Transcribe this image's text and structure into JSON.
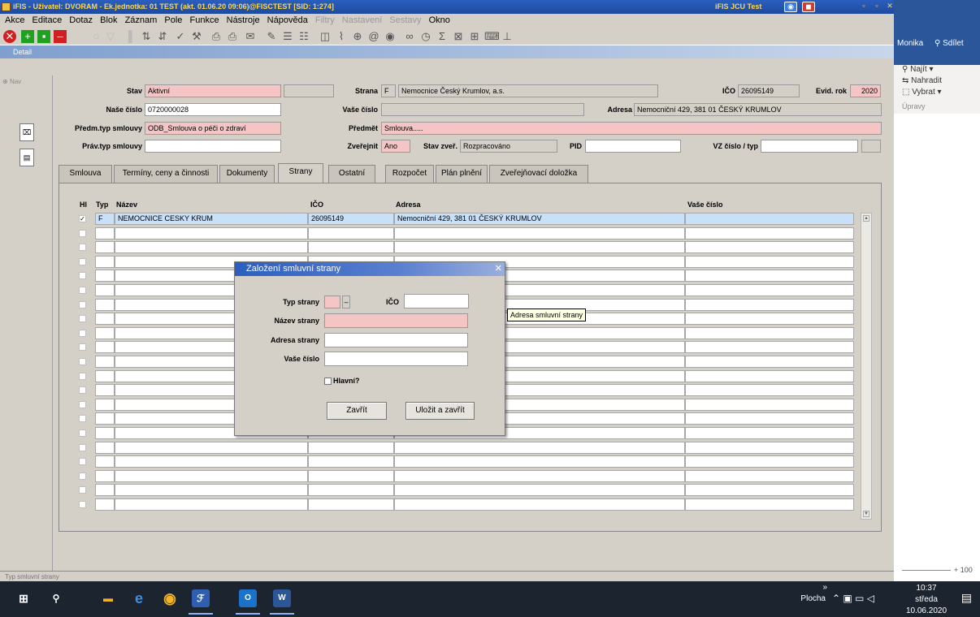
{
  "window": {
    "title": "iFIS - Uživatel: DVORAM - Ek.jednotka: 01 TEST (akt. 01.06.20 09:06)@FISCTEST [SID: 1:274]",
    "right_title": "iFIS JCU Test"
  },
  "menu": [
    "Akce",
    "Editace",
    "Dotaz",
    "Blok",
    "Záznam",
    "Pole",
    "Funkce",
    "Nástroje",
    "Nápověda"
  ],
  "menu_disabled": [
    "Filtry",
    "Nastavení",
    "Sestavy"
  ],
  "menu_last": "Okno",
  "detail_title": "Detail",
  "nav_label": "Nav",
  "form": {
    "stav_label": "Stav",
    "stav_value": "Aktivní",
    "strana_label": "Strana",
    "strana_code": "F",
    "strana_value": "Nemocnice Český Krumlov, a.s.",
    "ico_label": "IČO",
    "ico_value": "26095149",
    "evid_label": "Evid. rok",
    "evid_value": "2020",
    "nase_label": "Naše číslo",
    "nase_value": "0720000028",
    "vase_label": "Vaše číslo",
    "vase_value": "",
    "adresa_label": "Adresa",
    "adresa_value": "Nemocniční 429, 381 01 ČESKÝ KRUMLOV",
    "predm_typ_label": "Předm.typ smlouvy",
    "predm_typ_value": "ODB_Smlouva o péči o zdraví",
    "predmet_label": "Předmět",
    "predmet_value": "Smlouva.....",
    "prav_typ_label": "Práv.typ smlouvy",
    "prav_typ_value": "",
    "zverejnit_label": "Zveřejnit",
    "zverejnit_value": "Ano",
    "stav_zver_label": "Stav zveř.",
    "stav_zver_value": "Rozpracováno",
    "pid_label": "PID",
    "pid_value": "",
    "vz_label": "VZ číslo / typ",
    "vz_value": ""
  },
  "tabs": [
    "Smlouva",
    "Termíny, ceny a činnosti",
    "Dokumenty",
    "Strany",
    "Ostatní",
    "Rozpočet",
    "Plán plnění",
    "Zveřejňovací doložka"
  ],
  "grid": {
    "headers": [
      "Hl",
      "Typ",
      "Název",
      "IČO",
      "Adresa",
      "Vaše číslo"
    ],
    "first_row": {
      "checked": "✓",
      "typ": "F",
      "nazev": "NEMOCNICE CESKY KRUM",
      "ico": "26095149",
      "adresa": "Nemocniční 429, 381 01 ČESKÝ KRUMLOV",
      "vase": ""
    }
  },
  "dialog": {
    "title": "Založení smluvní strany",
    "typ_label": "Typ strany",
    "ico_label": "IČO",
    "nazev_label": "Název strany",
    "adresa_label": "Adresa strany",
    "vase_label": "Vaše číslo",
    "hlavni_label": "Hlavní?",
    "close_button": "Zavřít",
    "save_button": "Uložit a zavřít"
  },
  "tooltip": "Adresa smluvní strany",
  "status": "Typ smluvní strany",
  "office": {
    "user": "Monika",
    "share": "Sdílet",
    "find": "Najít",
    "replace": "Nahradit",
    "select": "Vybrat",
    "group": "Úpravy",
    "zoom": "100"
  },
  "taskbar": {
    "desktop": "Plocha",
    "time": "10:37",
    "day": "středa",
    "date": "10.06.2020"
  },
  "colors": {
    "required": "#f5c5c5",
    "title": "#2a5fbf"
  }
}
